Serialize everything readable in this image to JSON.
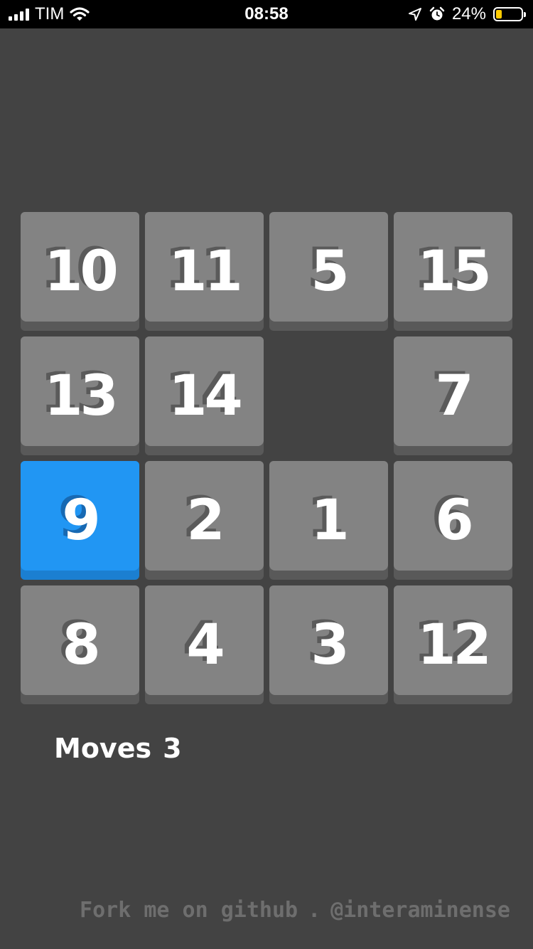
{
  "status_bar": {
    "carrier": "TIM",
    "time": "08:58",
    "battery_percent": "24%",
    "battery_level": 0.24,
    "icons": [
      "signal-icon",
      "wifi-icon",
      "location-arrow-icon",
      "alarm-icon",
      "battery-icon"
    ]
  },
  "board": {
    "size": 4,
    "tiles": [
      [
        "10",
        "11",
        "5",
        "15"
      ],
      [
        "13",
        "14",
        "",
        "7"
      ],
      [
        "9",
        "2",
        "1",
        "6"
      ],
      [
        "8",
        "4",
        "3",
        "12"
      ]
    ],
    "highlighted_tile": "9",
    "empty_cell": [
      1,
      2
    ]
  },
  "moves": {
    "label": "Moves",
    "count": "3"
  },
  "footer": {
    "link_text": "Fork me on github",
    "separator": ".",
    "handle": "@interaminense"
  },
  "colors": {
    "background": "#434343",
    "tile": "#838383",
    "tile_shadow": "#595959",
    "highlight": "#2196f3",
    "battery_fill": "#ffcc00",
    "footer_text": "#6e6e6e"
  }
}
